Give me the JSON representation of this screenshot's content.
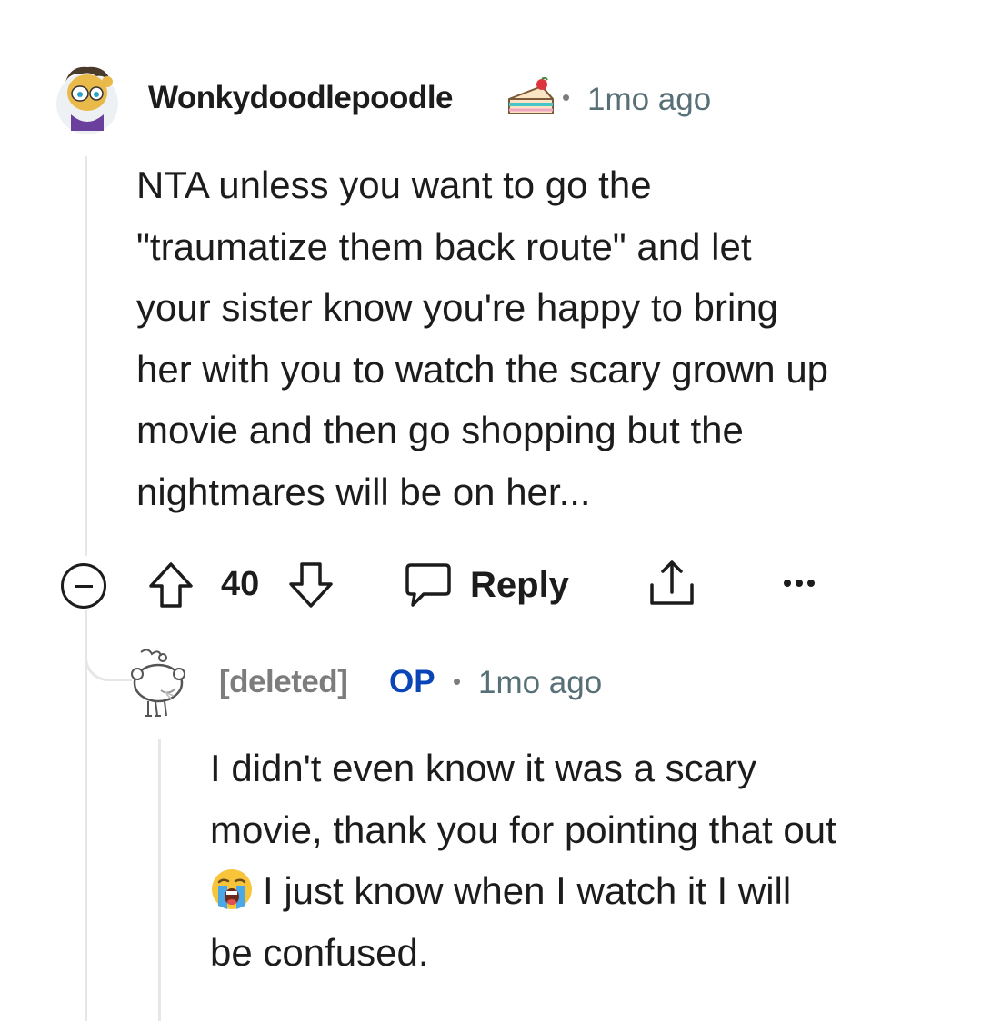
{
  "comment1": {
    "username": "Wonkydoodlepoodle",
    "separator": "•",
    "timestamp": "1mo ago",
    "body": "NTA unless you want to go the\n\"traumatize them back route\" and let\nyour sister know you're happy to bring\nher with you to watch the scary grown up\nmovie and then go shopping but the\nnightmares will be on her...",
    "badge_icon": "cake-slice-icon",
    "avatar_icon": "snoo-avatar-icon"
  },
  "actions": {
    "collapse_icon": "collapse-icon",
    "upvote_icon": "upvote-arrow-icon",
    "vote_count": "40",
    "downvote_icon": "downvote-arrow-icon",
    "reply_icon": "speech-bubble-icon",
    "reply_label": "Reply",
    "share_icon": "share-icon",
    "more_icon": "more-dots-icon"
  },
  "comment2": {
    "username": "[deleted]",
    "op_label": "OP",
    "separator": "•",
    "timestamp": "1mo ago",
    "body_line1": "I didn't even know it was a scary\nmovie, thank you for pointing that out",
    "body_line2": "I just know when I watch it I will\nbe confused.",
    "emoji": "loudly-crying-face-icon",
    "avatar_icon": "deleted-snoo-icon"
  },
  "colors": {
    "text": "#1c1c1c",
    "meta": "#576f76",
    "deleted": "#7c7c7c",
    "op": "#0a45b8",
    "thread_line": "#e6e6e6"
  }
}
